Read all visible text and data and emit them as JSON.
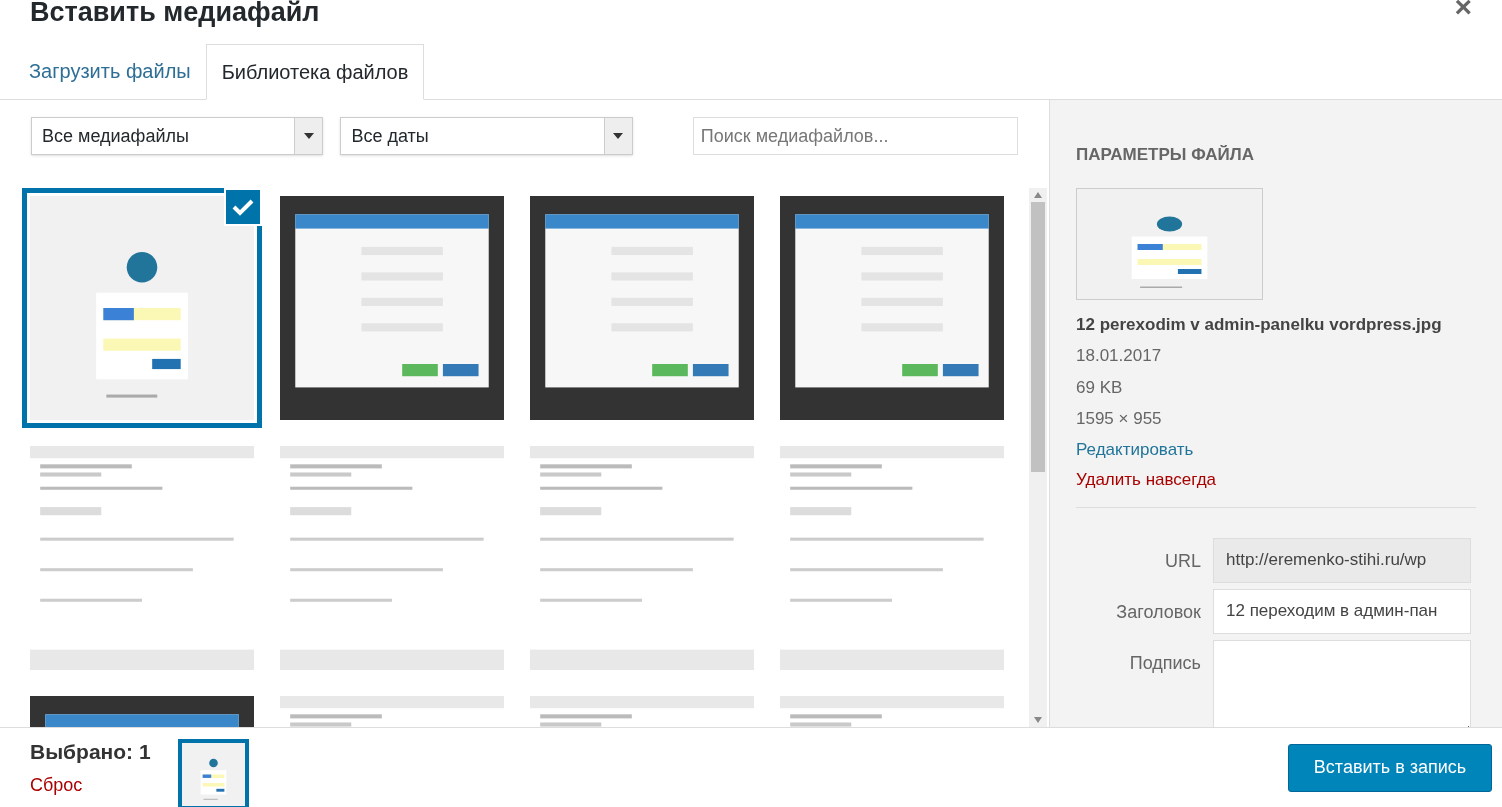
{
  "modal": {
    "title": "Вставить медиафайл",
    "close": "×"
  },
  "tabs": [
    {
      "label": "Загрузить файлы",
      "selected": false
    },
    {
      "label": "Библиотека файлов",
      "selected": true
    }
  ],
  "filters": [
    {
      "value": "Все медиафайлы"
    },
    {
      "value": "Все даты"
    }
  ],
  "search": {
    "placeholder": "Поиск медиафайлов..."
  },
  "attachments": [
    {
      "kind": "login",
      "selected": true
    },
    {
      "kind": "dialog",
      "selected": false
    },
    {
      "kind": "dialog",
      "selected": false
    },
    {
      "kind": "dialog",
      "selected": false
    },
    {
      "kind": "page",
      "selected": false
    },
    {
      "kind": "page",
      "selected": false
    },
    {
      "kind": "page",
      "selected": false
    },
    {
      "kind": "page",
      "selected": false
    },
    {
      "kind": "dialog",
      "selected": false
    },
    {
      "kind": "page",
      "selected": false
    },
    {
      "kind": "page",
      "selected": false
    },
    {
      "kind": "page",
      "selected": false
    }
  ],
  "details": {
    "heading": "ПАРАМЕТРЫ ФАЙЛА",
    "filename": "12 perexodim v admin-panelku vordpress.jpg",
    "date": "18.01.2017",
    "size": "69 KB",
    "dimensions": "1595 × 955",
    "edit_link": "Редактировать",
    "delete_link": "Удалить навсегда",
    "fields": [
      {
        "label": "URL",
        "value": "http://eremenko-stihi.ru/wp",
        "kind": "input"
      },
      {
        "label": "Заголовок",
        "value": "12 переходим в админ-пан",
        "kind": "input"
      },
      {
        "label": "Подпись",
        "kind": "textarea"
      }
    ]
  },
  "footer": {
    "selected_count": "Выбрано: 1",
    "reset": "Сброс",
    "insert_button": "Вставить в запись"
  }
}
